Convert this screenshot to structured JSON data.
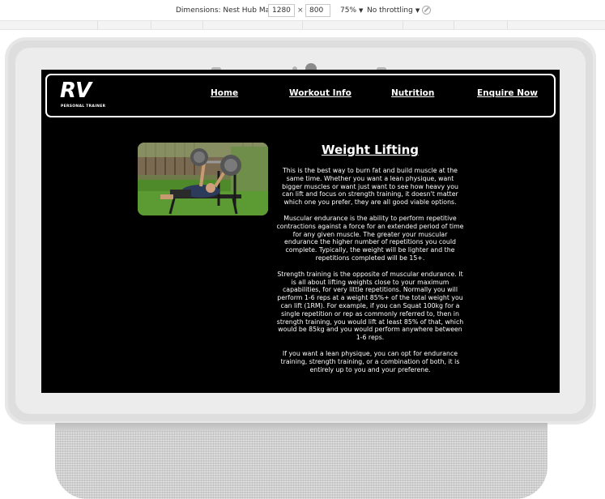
{
  "devtools": {
    "dimensions_label": "Dimensions: Nest Hub Max",
    "width": "1280",
    "height": "800",
    "zoom": "75%",
    "throttling": "No throttling"
  },
  "nav": {
    "logo_text": "RV",
    "logo_tagline": "PERSONAL TRAINER",
    "home": "Home",
    "workout": "Workout Info",
    "nutrition": "Nutrition",
    "enquire": "Enquire Now"
  },
  "article": {
    "title": "Weight Lifting",
    "p1": "This is the best way to burn fat and build muscle at the same time. Whether you want a lean physique, want bigger muscles or want just want to see how heavy you can lift and focus on strength training, it doesn't matter which one you prefer, they are all good viable options.",
    "p2": "Muscular endurance is the ability to perform repetitive contractions against a force for an extended period of time for any given muscle. The greater your muscular endurance the higher number of repetitions you could complete. Typically, the weight will be lighter and the repetitions completed will be 15+.",
    "p3": "Strength training is the opposite of muscular endurance. It is all about lifting weights close to your maximum capabilities, for very little repetitions. Normally you will perform 1-6 reps at a weight 85%+ of the total weight you can lift (1RM). For example, if you can Squat 100kg for a single repetition or rep as commonly referred to, then in strength training, you would lift at least 85% of that, which would be 85kg and you would perform anywhere between 1-6 reps.",
    "p4": "If you want a lean physique, you can opt for endurance training, strength training, or a combination of both, it is entirely up to you and your preferene."
  },
  "colors": {
    "screen_bg": "#000000",
    "text": "#ffffff",
    "device_frame": "#dedede"
  },
  "icons": [
    "dropdown-arrow-icon",
    "rotate-icon",
    "camera-icon",
    "bench-press-photo"
  ]
}
